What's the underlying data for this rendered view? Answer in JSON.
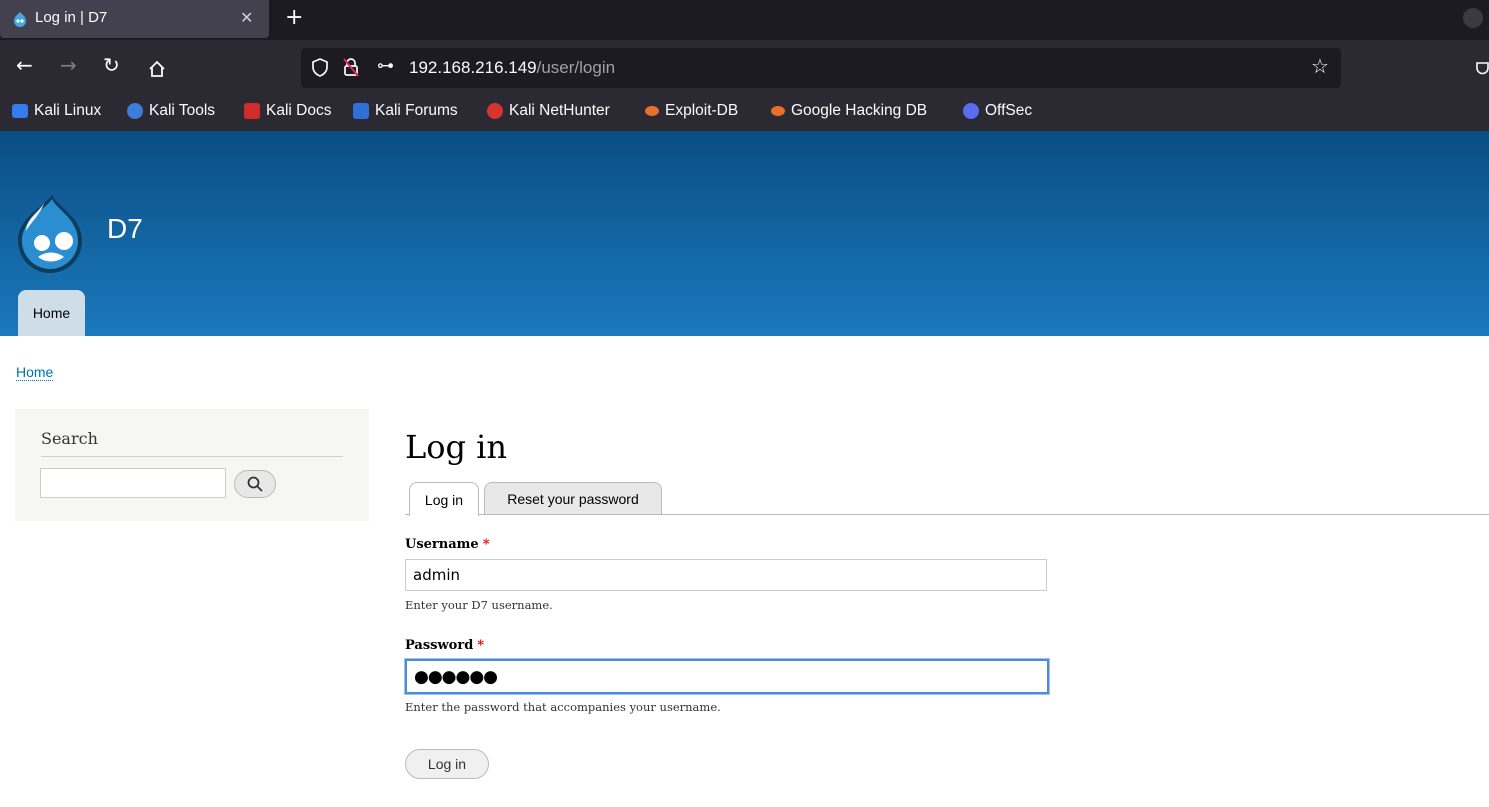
{
  "browser": {
    "tab_title": "Log in | D7",
    "url_host": "192.168.216.149",
    "url_path": "/user/login",
    "bookmarks": [
      {
        "label": "Kali Linux",
        "color": "#367bf0"
      },
      {
        "label": "Kali Tools",
        "color": "#3d7cd9"
      },
      {
        "label": "Kali Docs",
        "color": "#d12b2b"
      },
      {
        "label": "Kali Forums",
        "color": "#2f6fd8"
      },
      {
        "label": "Kali NetHunter",
        "color": "#d9322f"
      },
      {
        "label": "Exploit-DB",
        "color": "#e8702a"
      },
      {
        "label": "Google Hacking DB",
        "color": "#e8702a"
      },
      {
        "label": "OffSec",
        "color": "#5a6cf0"
      }
    ]
  },
  "site": {
    "name": "D7",
    "nav_home": "Home",
    "breadcrumb": "Home"
  },
  "sidebar": {
    "search_title": "Search",
    "search_value": ""
  },
  "main": {
    "title": "Log in",
    "tabs": [
      {
        "label": "Log in",
        "active": true
      },
      {
        "label": "Reset your password",
        "active": false
      }
    ],
    "username_label": "Username",
    "username_value": "admin",
    "username_desc": "Enter your D7 username.",
    "password_label": "Password",
    "password_value": "●●●●●●",
    "password_desc": "Enter the password that accompanies your username.",
    "required_mark": "*",
    "submit_label": "Log in"
  }
}
